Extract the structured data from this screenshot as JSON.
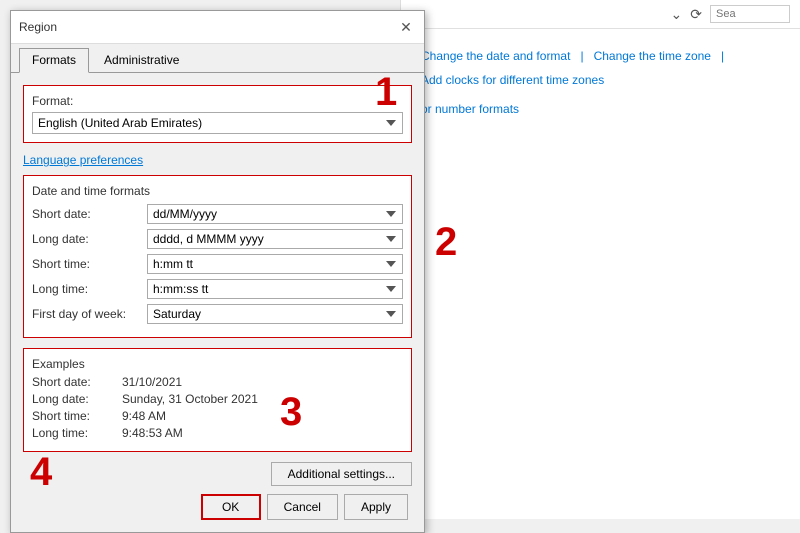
{
  "dialog": {
    "title": "Region",
    "close_label": "✕",
    "tabs": [
      {
        "label": "Formats",
        "active": true
      },
      {
        "label": "Administrative",
        "active": false
      }
    ],
    "format_section": {
      "label": "Format:",
      "value": "English (United Arab Emirates)"
    },
    "lang_pref_link": "Language preferences",
    "datetime_section": {
      "title": "Date and time formats",
      "rows": [
        {
          "label": "Short date:",
          "value": "dd/MM/yyyy"
        },
        {
          "label": "Long date:",
          "value": "dddd, d MMMM yyyy"
        },
        {
          "label": "Short time:",
          "value": "h:mm tt"
        },
        {
          "label": "Long time:",
          "value": "h:mm:ss tt"
        },
        {
          "label": "First day of week:",
          "value": "Saturday"
        }
      ]
    },
    "examples_section": {
      "title": "Examples",
      "rows": [
        {
          "label": "Short date:",
          "value": "31/10/2021"
        },
        {
          "label": "Long date:",
          "value": "Sunday, 31 October 2021"
        },
        {
          "label": "Short time:",
          "value": "9:48 AM"
        },
        {
          "label": "Long time:",
          "value": "9:48:53 AM"
        }
      ]
    },
    "additional_btn": "Additional settings...",
    "ok_btn": "OK",
    "cancel_btn": "Cancel",
    "apply_btn": "Apply"
  },
  "background": {
    "links": [
      {
        "label": "Change the date and format"
      },
      {
        "label": "Change the time zone"
      },
      {
        "label": "Add clocks for different time zones"
      }
    ],
    "number_formats": "or number formats"
  },
  "annotations": [
    {
      "id": "1",
      "text": "1"
    },
    {
      "id": "2",
      "text": "2"
    },
    {
      "id": "3",
      "text": "3"
    },
    {
      "id": "4",
      "text": "4"
    }
  ]
}
